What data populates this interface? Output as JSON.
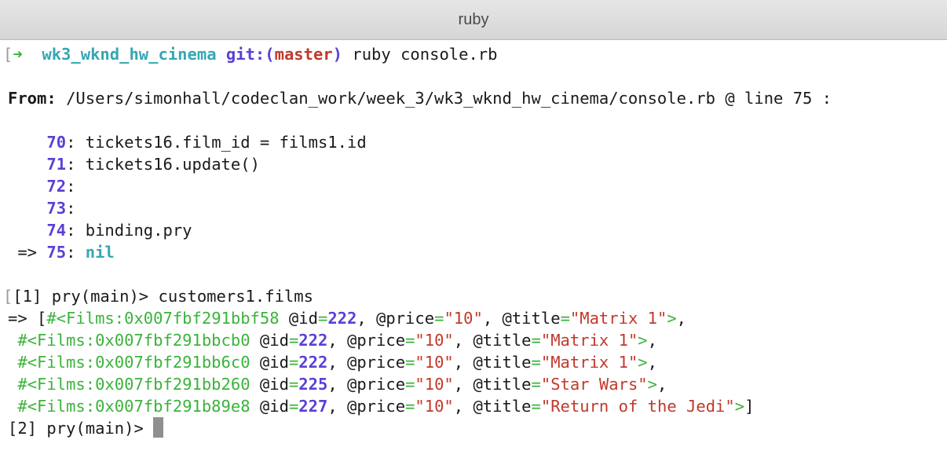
{
  "window": {
    "title": "ruby"
  },
  "prompt": {
    "mark": "[",
    "arrow": "➜",
    "dir": "wk3_wknd_hw_cinema",
    "git_prefix": "git:(",
    "branch": "master",
    "git_suffix": ")",
    "command": "ruby console.rb"
  },
  "from": {
    "label": "From:",
    "path": "/Users/simonhall/codeclan_work/week_3/wk3_wknd_hw_cinema/console.rb @ line 75 :"
  },
  "source_lines": [
    {
      "num": "70",
      "code": "tickets16.film_id = films1.id"
    },
    {
      "num": "71",
      "code": "tickets16.update()"
    },
    {
      "num": "72",
      "code": ""
    },
    {
      "num": "73",
      "code": ""
    },
    {
      "num": "74",
      "code": "binding.pry"
    },
    {
      "num": "75",
      "code": "nil",
      "current": true
    }
  ],
  "current_marker": "=>",
  "pry": {
    "input1_mark": "[",
    "input1": "[1] pry(main)> customers1.films",
    "result_arrow": "=>",
    "results": [
      {
        "obj": "#<Films:0x007fbf291bbf58",
        "id": "222",
        "price": "\"10\"",
        "title": "\"Matrix 1\""
      },
      {
        "obj": "#<Films:0x007fbf291bbcb0",
        "id": "222",
        "price": "\"10\"",
        "title": "\"Matrix 1\""
      },
      {
        "obj": "#<Films:0x007fbf291bb6c0",
        "id": "222",
        "price": "\"10\"",
        "title": "\"Matrix 1\""
      },
      {
        "obj": "#<Films:0x007fbf291bb260",
        "id": "225",
        "price": "\"10\"",
        "title": "\"Star Wars\""
      },
      {
        "obj": "#<Films:0x007fbf291b89e8",
        "id": "227",
        "price": "\"10\"",
        "title": "\"Return of the Jedi\""
      }
    ],
    "input2": "[2] pry(main)> "
  }
}
